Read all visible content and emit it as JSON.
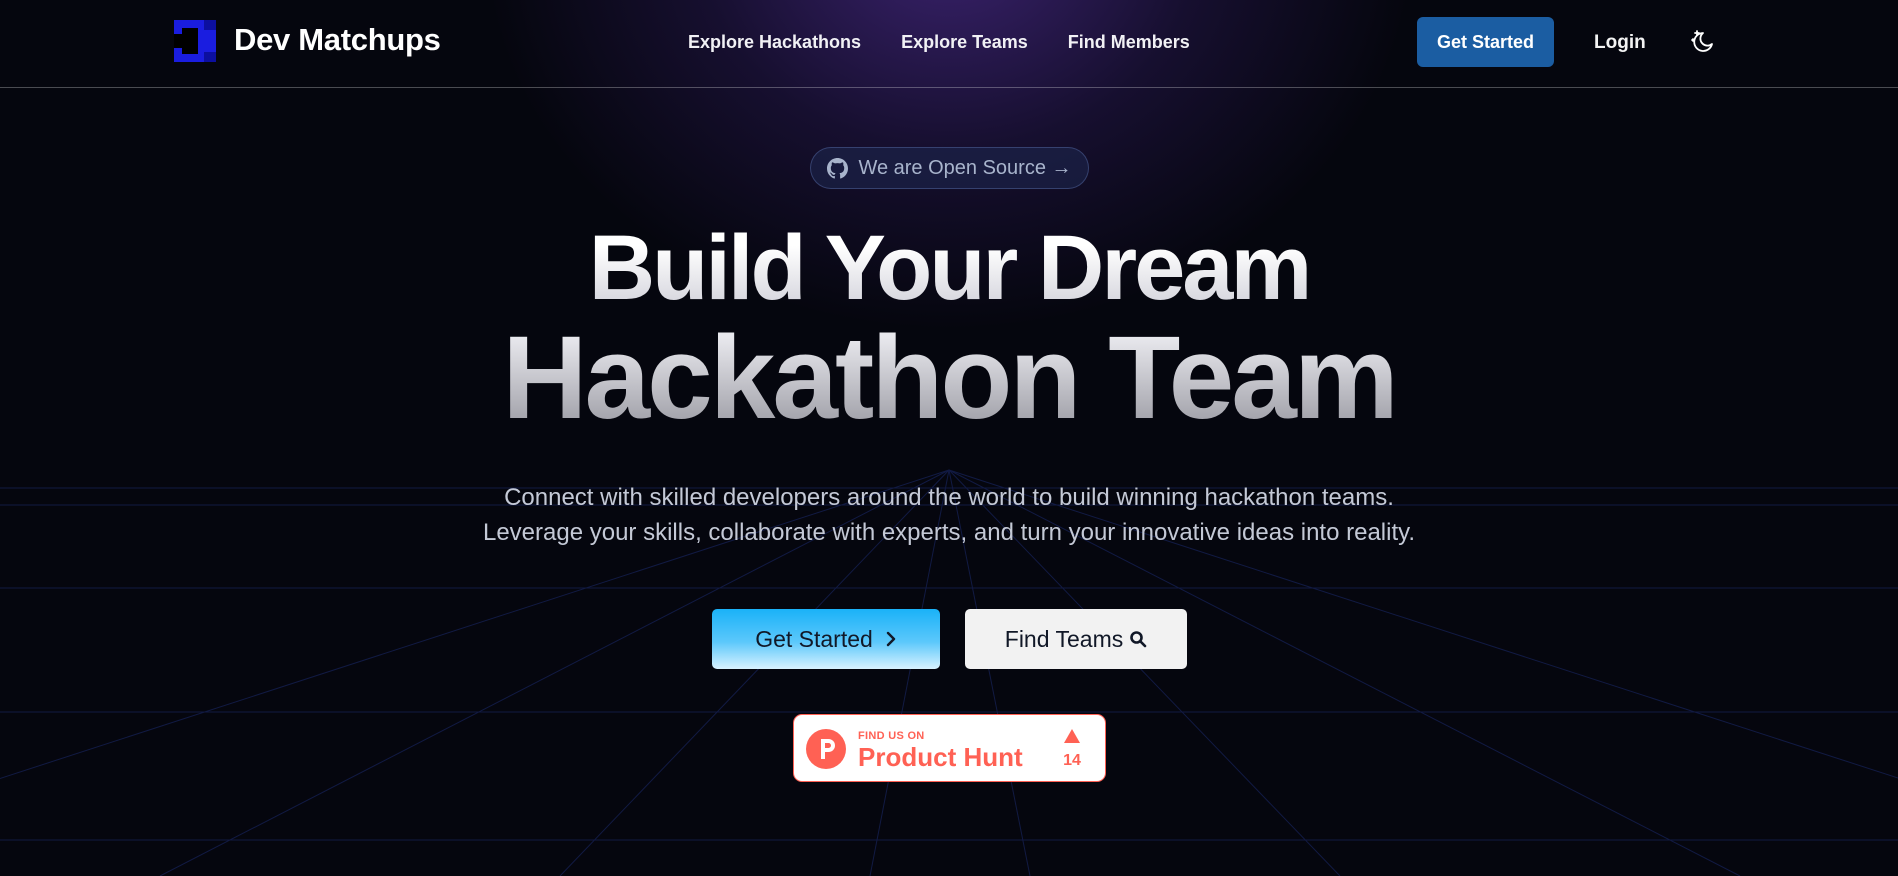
{
  "header": {
    "brand": "Dev Matchups",
    "nav": [
      "Explore Hackathons",
      "Explore Teams",
      "Find Members"
    ],
    "get_started": "Get Started",
    "login": "Login"
  },
  "hero": {
    "badge": "We are Open Source →",
    "title_line1": "Build Your Dream",
    "title_line2": "Hackathon Team",
    "subtitle_line1": "Connect with skilled developers around the world to build winning hackathon teams.",
    "subtitle_line2": "Leverage your skills, collaborate with experts, and turn your innovative ideas into reality.",
    "primary_button": "Get Started",
    "secondary_button": "Find Teams"
  },
  "product_hunt": {
    "small": "FIND US ON",
    "big": "Product Hunt",
    "count": "14"
  },
  "icons": {
    "logo": "dev-matchups-logo",
    "theme": "moon-stars-icon",
    "badge": "github-icon",
    "primary_button": "chevron-right-icon",
    "secondary_button": "search-icon",
    "product_hunt": "product-hunt-icon",
    "upvote": "triangle-up-icon"
  },
  "colors": {
    "background": "#05060e",
    "glow": "#5c34aa",
    "header_button": "#1b5da2",
    "primary_button": "#1ab2f8",
    "product_hunt": "#ff6154",
    "logo": "#1a1de0"
  }
}
